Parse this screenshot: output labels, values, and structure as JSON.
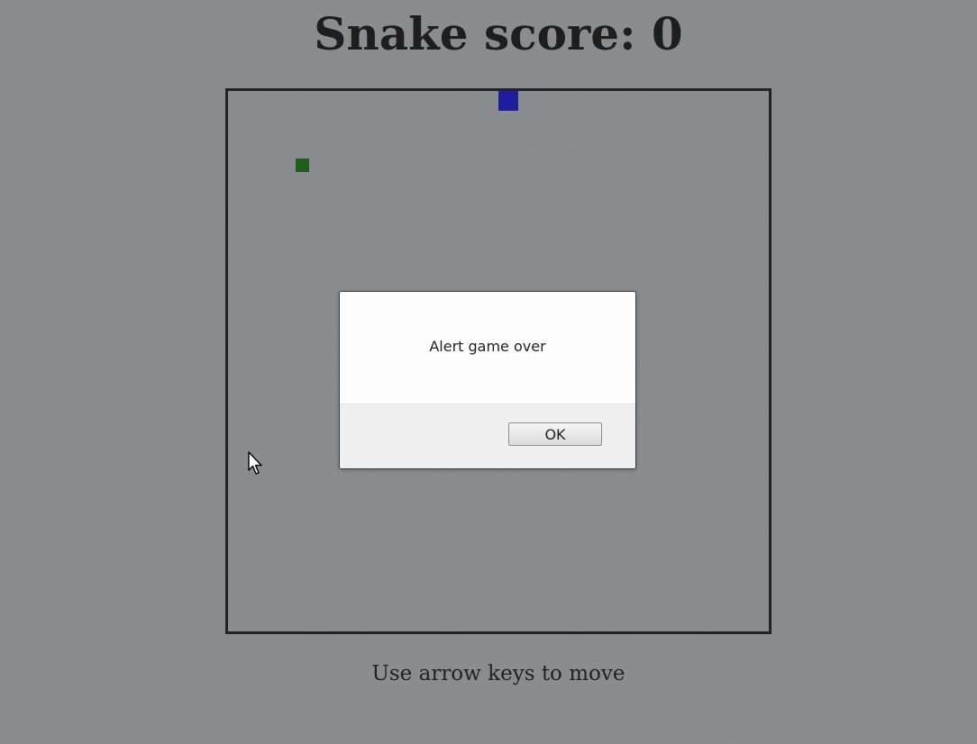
{
  "header": {
    "title": "Snake score: 0"
  },
  "game": {
    "score": 0,
    "colors": {
      "snake": "#1f1e9a",
      "food": "#1f5e1f",
      "border": "#222325",
      "background": "#8b8c8f"
    }
  },
  "dialog": {
    "message": "Alert game over",
    "ok_label": "OK"
  },
  "footer": {
    "instructions": "Use arrow keys to move"
  },
  "icons": {
    "cursor": "mouse-cursor-icon"
  }
}
